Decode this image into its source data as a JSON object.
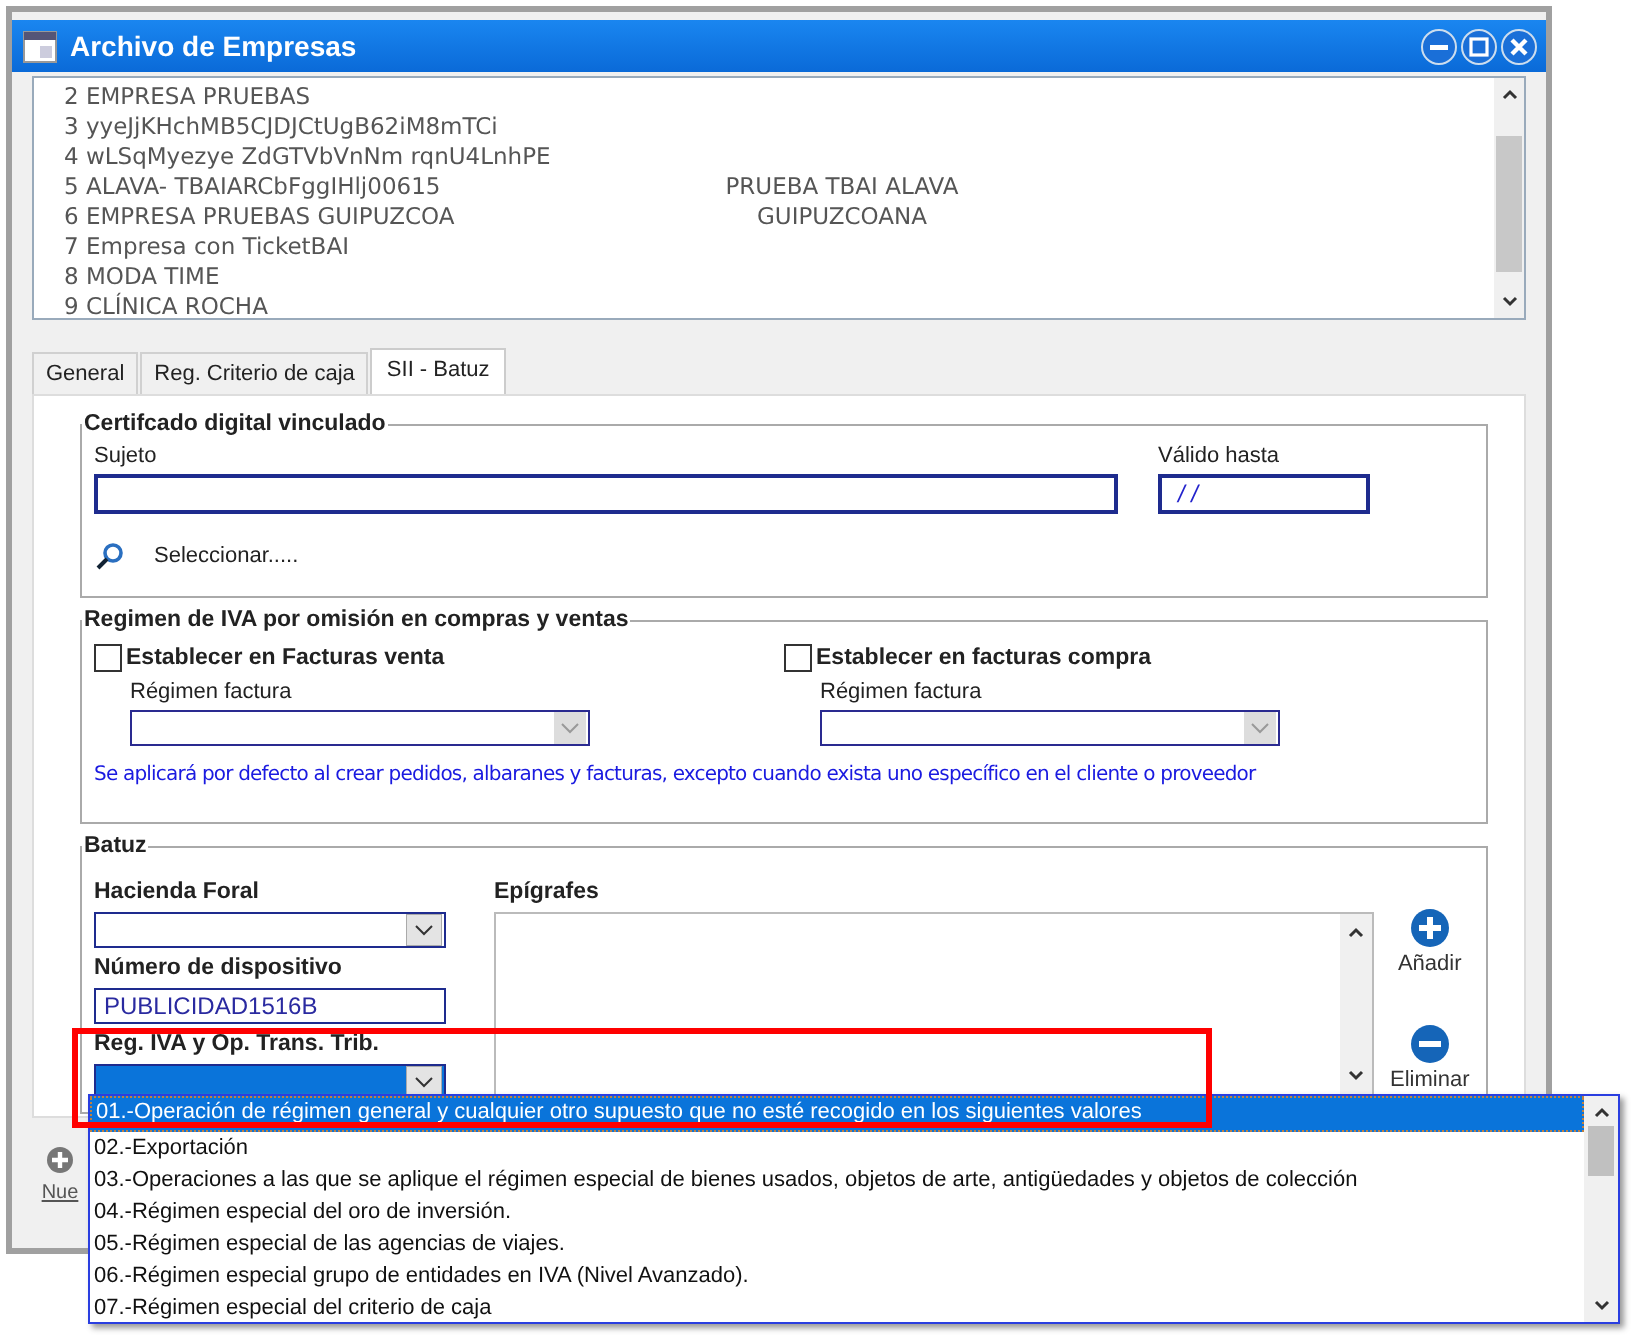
{
  "window": {
    "title": "Archivo de Empresas"
  },
  "company_list": {
    "rows": [
      {
        "column_1": "2 EMPRESA PRUEBAS"
      },
      {
        "column_1": "3 yyeJjKHchMB5CJDJCtUgB62iM8mTCi"
      },
      {
        "column_1": "4 wLSqMyezye ZdGTVbVnNm rqnU4LnhPE"
      },
      {
        "column_1": "5 ALAVA- TBAIARCbFggIHlj00615",
        "column_2": "PRUEBA TBAI ALAVA"
      },
      {
        "column_1": "6 EMPRESA PRUEBAS GUIPUZCOA",
        "column_2": "GUIPUZCOANA"
      },
      {
        "column_1": "7 Empresa con TicketBAI"
      },
      {
        "column_1": "8 MODA TIME"
      },
      {
        "column_1": "9 CLÍNICA ROCHA"
      }
    ]
  },
  "tabs": [
    {
      "label": "General",
      "selected": false
    },
    {
      "label": "Reg. Criterio de caja",
      "selected": false
    },
    {
      "label": "SII - Batuz",
      "selected": true
    }
  ],
  "certificate": {
    "legend": "Certifcado digital vinculado",
    "subject_label": "Sujeto",
    "valid_until_label": "Válido hasta",
    "valid_until_value": "/ /",
    "select_link": "Seleccionar....."
  },
  "vat_regime": {
    "legend": "Regimen de IVA por omisión en compras y ventas",
    "options": [
      {
        "label": "Establecer en Facturas venta",
        "checked": false,
        "field_label": "Régimen factura"
      },
      {
        "label": "Establecer en facturas compra",
        "checked": false,
        "field_label": "Régimen factura"
      }
    ],
    "note": "Se aplicará por defecto al crear pedidos, albaranes y facturas, excepto cuando exista uno específico en el cliente o proveedor"
  },
  "batuz": {
    "legend": "Batuz",
    "hacienda_label": "Hacienda Foral",
    "device_label": "Número de dispositivo",
    "device_value": "PUBLICIDAD1516B",
    "reg_label": "Reg. IVA y Op. Trans. Trib.",
    "reg_focused": true,
    "epigrafes_label": "Epígrafes",
    "add_button": "Añadir",
    "remove_button": "Eliminar"
  },
  "dropdown": {
    "options": [
      {
        "label": "01.-Operación de régimen general y cualquier otro supuesto que no esté recogido en los siguientes valores",
        "selected": true
      },
      {
        "label": "02.-Exportación",
        "selected": false
      },
      {
        "label": "03.-Operaciones a las que se aplique el régimen especial de bienes usados, objetos de arte, antigüedades y objetos de colección",
        "selected": false
      },
      {
        "label": "04.-Régimen especial del oro de inversión.",
        "selected": false
      },
      {
        "label": "05.-Régimen especial de las agencias de viajes.",
        "selected": false
      },
      {
        "label": "06.-Régimen especial grupo de entidades en IVA (Nivel Avanzado).",
        "selected": false
      },
      {
        "label": "07.-Régimen especial del criterio de caja",
        "selected": false
      }
    ]
  },
  "footer": {
    "new_button": "Nue"
  }
}
